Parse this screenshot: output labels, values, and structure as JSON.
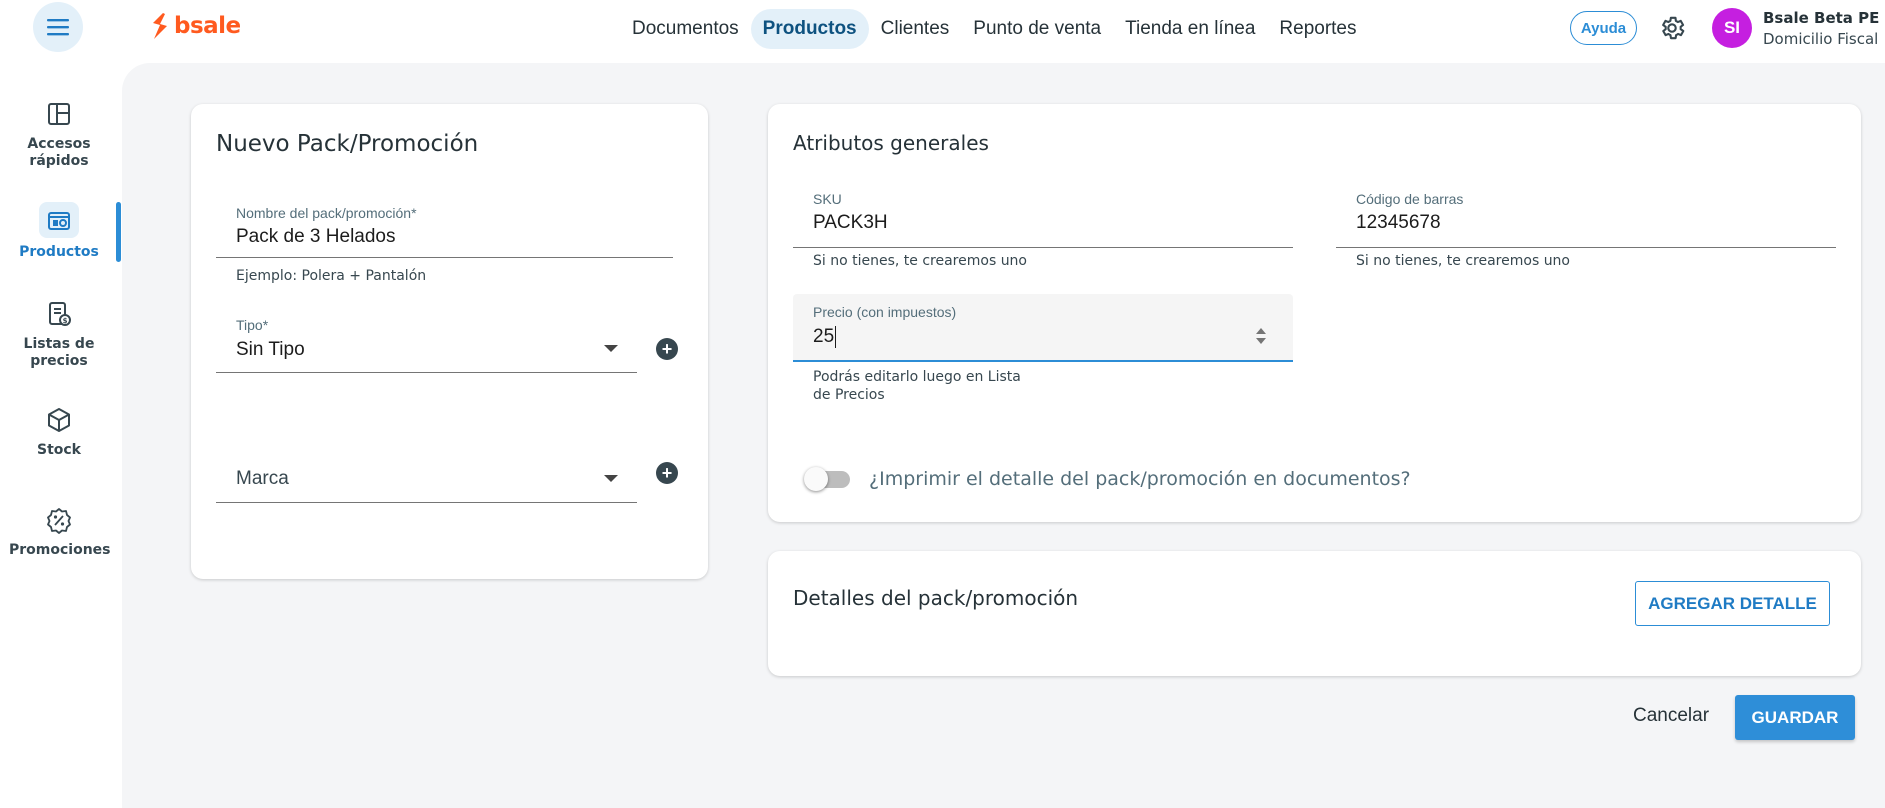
{
  "app": {
    "brand": "bsale"
  },
  "nav": {
    "items": [
      {
        "label": "Documentos",
        "active": false
      },
      {
        "label": "Productos",
        "active": true
      },
      {
        "label": "Clientes",
        "active": false
      },
      {
        "label": "Punto de venta",
        "active": false
      },
      {
        "label": "Tienda en línea",
        "active": false
      },
      {
        "label": "Reportes",
        "active": false
      }
    ]
  },
  "header": {
    "help_label": "Ayuda",
    "avatar_initials": "SI",
    "user_name": "Bsale Beta PE",
    "user_sub": "Domicilio Fiscal",
    "avatar_color": "#c51fe0"
  },
  "sidebar": {
    "items": [
      {
        "label": "Accesos rápidos",
        "icon": "layout-icon"
      },
      {
        "label": "Productos",
        "icon": "products-icon",
        "active": true
      },
      {
        "label": "Listas de precios",
        "icon": "price-list-icon"
      },
      {
        "label": "Stock",
        "icon": "cube-icon"
      },
      {
        "label": "Promociones",
        "icon": "discount-badge-icon"
      }
    ]
  },
  "pack_card": {
    "title": "Nuevo Pack/Promoción",
    "name_label": "Nombre del pack/promoción*",
    "name_value": "Pack de 3 Helados",
    "name_helper": "Ejemplo: Polera + Pantalón",
    "type_label": "Tipo*",
    "type_value": "Sin Tipo",
    "brand_placeholder": "Marca"
  },
  "attributes_card": {
    "title": "Atributos generales",
    "sku_label": "SKU",
    "sku_value": "PACK3H",
    "sku_helper": "Si no tienes, te crearemos uno",
    "barcode_label": "Código de barras",
    "barcode_value": "12345678",
    "barcode_helper": "Si no tienes, te crearemos uno",
    "price_label": "Precio (con impuestos)",
    "price_value": "25",
    "price_helper_line1": "Podrás editarlo luego en Lista",
    "price_helper_line2": "de Precios",
    "print_toggle_label": "¿Imprimir el detalle del pack/promoción en documentos?",
    "print_toggle_on": false
  },
  "details_card": {
    "title": "Detalles del pack/promoción",
    "add_button": "AGREGAR DETALLE"
  },
  "actions": {
    "cancel": "Cancelar",
    "save": "GUARDAR"
  },
  "colors": {
    "accent": "#2c8dd6",
    "brand": "#ff5a1f",
    "background": "#f4f5f7"
  }
}
